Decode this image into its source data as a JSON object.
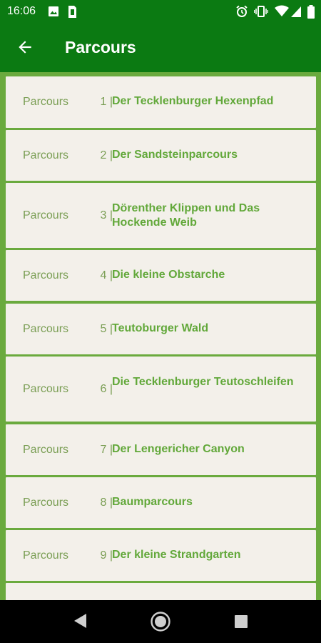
{
  "status_bar": {
    "time": "16:06",
    "icons_left": [
      "image-icon",
      "sim-icon"
    ],
    "icons_right": [
      "alarm-icon",
      "vibrate-icon",
      "wifi-icon",
      "signal-icon",
      "battery-icon"
    ]
  },
  "app_bar": {
    "title": "Parcours",
    "back_icon": "arrow-left-icon"
  },
  "colors": {
    "primary": "#0b7a12",
    "list_background": "#6aaa3e",
    "card_background": "#f3f0ea",
    "accent_text": "#62a83a",
    "muted_text": "#7a9e54"
  },
  "parcours": [
    {
      "prefix": "Parcours",
      "number": "1 |",
      "name": "Der Tecklenburger Hexenpfad"
    },
    {
      "prefix": "Parcours",
      "number": "2 |",
      "name": "Der Sandsteinparcours"
    },
    {
      "prefix": "Parcours",
      "number": "3 |",
      "name": "Dörenther Klippen und Das Hockende Weib"
    },
    {
      "prefix": "Parcours",
      "number": "4 |",
      "name": "Die kleine Obstarche"
    },
    {
      "prefix": "Parcours",
      "number": "5 |",
      "name": "Teutoburger Wald"
    },
    {
      "prefix": "Parcours",
      "number": "6 |",
      "name": "Die Tecklenburger Teutoschleifen"
    },
    {
      "prefix": "Parcours",
      "number": "7 |",
      "name": "Der Lengericher Canyon"
    },
    {
      "prefix": "Parcours",
      "number": "8 |",
      "name": "Baumparcours"
    },
    {
      "prefix": "Parcours",
      "number": "9 |",
      "name": "Der kleine Strandgarten"
    }
  ],
  "nav_bar": {
    "buttons": [
      "back-triangle-icon",
      "home-circle-icon",
      "recents-square-icon"
    ]
  }
}
